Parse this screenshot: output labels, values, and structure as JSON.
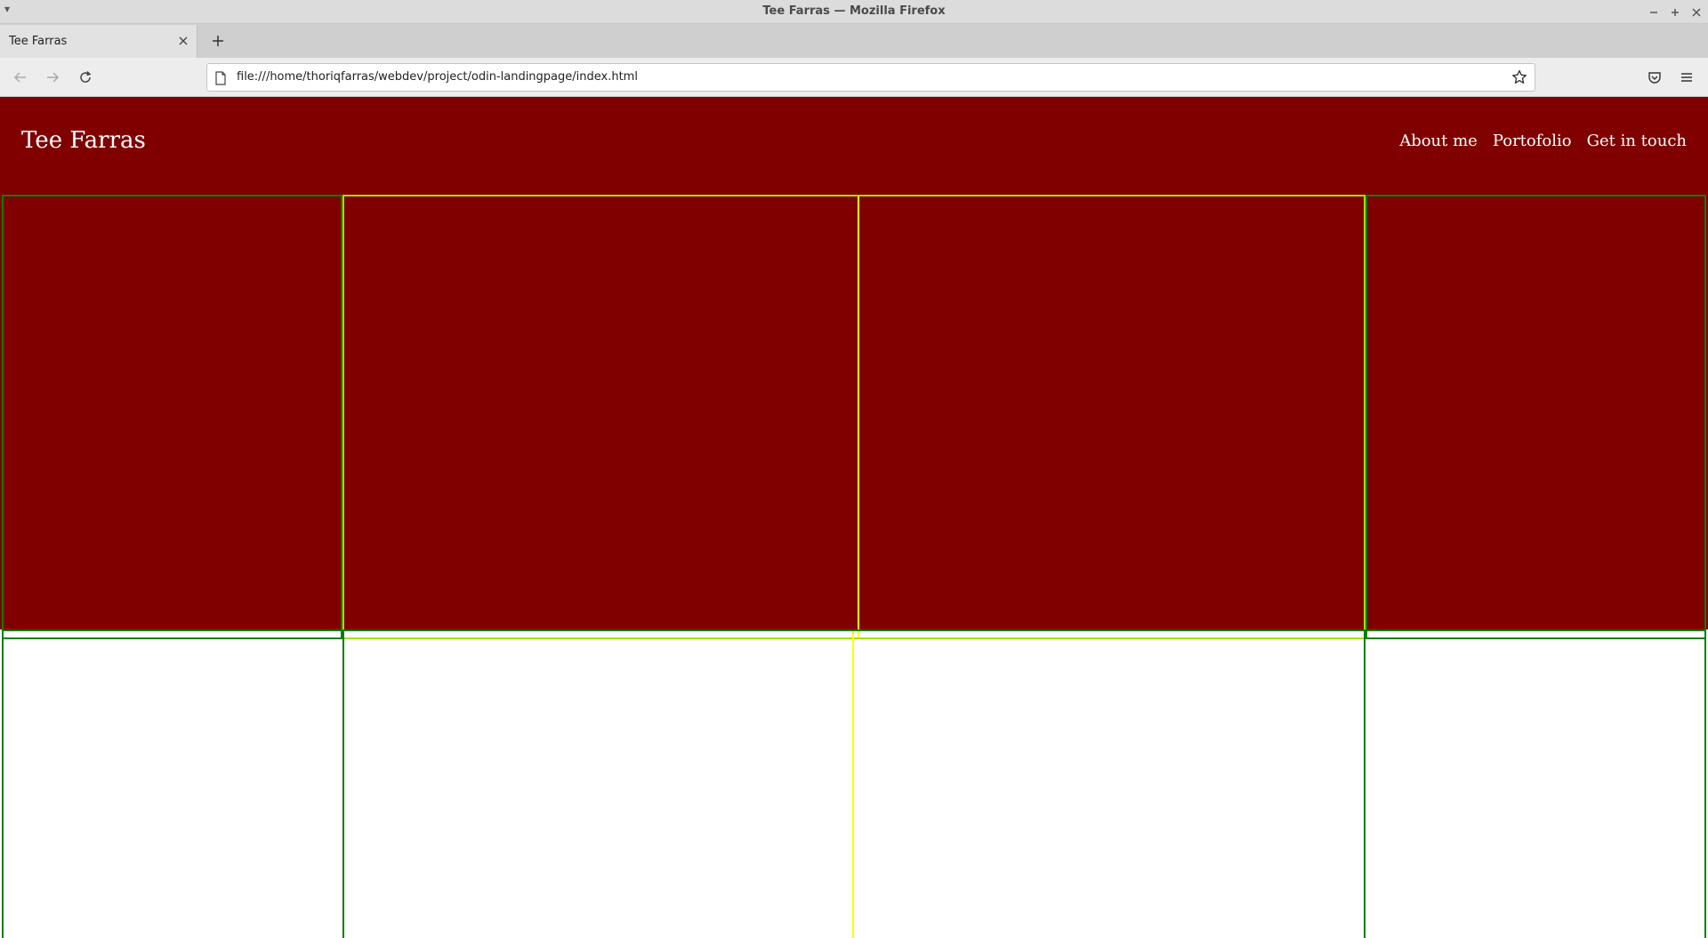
{
  "window": {
    "title": "Tee Farras — Mozilla Firefox"
  },
  "tabs": [
    {
      "label": "Tee Farras",
      "active": true
    }
  ],
  "address_bar": {
    "url": "file:///home/thoriqfarras/webdev/project/odin-landingpage/index.html"
  },
  "page": {
    "header": {
      "logo": "Tee Farras",
      "nav": [
        {
          "label": "About me"
        },
        {
          "label": "Portofolio"
        },
        {
          "label": "Get in touch"
        }
      ]
    }
  },
  "colors": {
    "header_bg": "#800000",
    "hero_bg": "#800000",
    "outline_green": "#008000",
    "outline_lime": "#a8e000",
    "outline_yellow": "#ffff00"
  },
  "icons": {
    "window_menu": "chevron-down-icon",
    "minimize": "minimize-icon",
    "maximize": "maximize-icon",
    "close": "close-icon",
    "tab_close": "close-icon",
    "new_tab": "plus-icon",
    "back": "arrow-left-icon",
    "forward": "arrow-right-icon",
    "reload": "reload-icon",
    "page": "page-icon",
    "bookmark": "star-icon",
    "pocket": "pocket-icon",
    "menu": "hamburger-icon"
  }
}
